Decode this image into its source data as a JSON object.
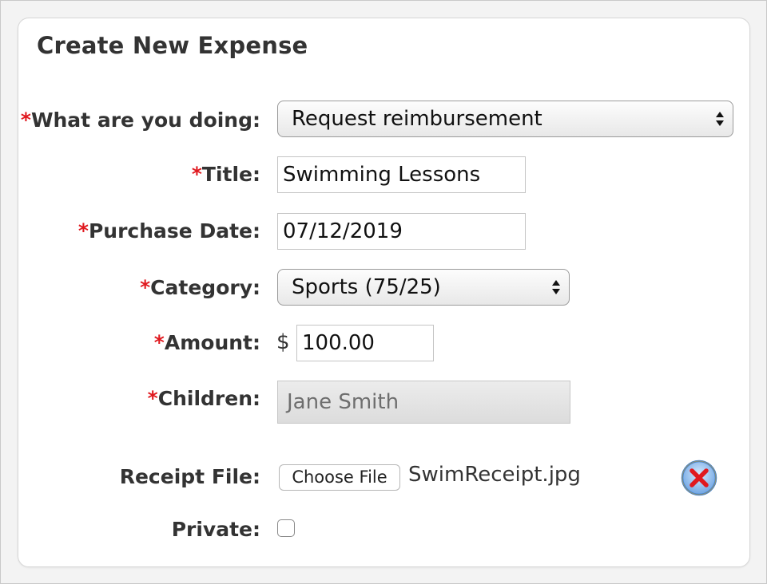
{
  "form": {
    "title": "Create New Expense",
    "required_marker": "*",
    "fields": {
      "doing": {
        "label": "What are you doing:",
        "value": "Request reimbursement"
      },
      "title": {
        "label": "Title:",
        "value": "Swimming Lessons"
      },
      "purchase_date": {
        "label": "Purchase Date:",
        "value": "07/12/2019"
      },
      "category": {
        "label": "Category:",
        "value": "Sports (75/25)"
      },
      "amount": {
        "label": "Amount:",
        "currency": "$",
        "value": "100.00"
      },
      "children": {
        "label": "Children:",
        "value": "Jane Smith"
      },
      "receipt": {
        "label": "Receipt File:",
        "button": "Choose File",
        "filename": "SwimReceipt.jpg"
      },
      "private": {
        "label": "Private:",
        "checked": false
      }
    }
  },
  "colors": {
    "required": "#e0191f",
    "remove_icon_ring": "#3f7fd0",
    "remove_icon_x": "#e0191f"
  },
  "icons": {
    "select_arrows": "up-down-arrows-icon",
    "remove": "remove-file-icon"
  }
}
